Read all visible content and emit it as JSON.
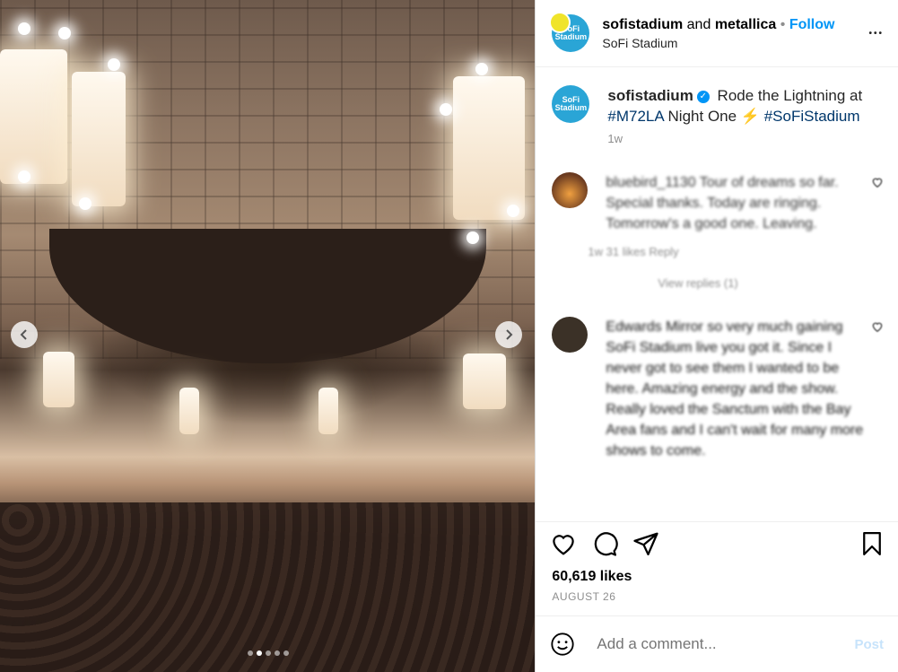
{
  "header": {
    "account": "sofistadium",
    "conjunction": "and",
    "collaborator": "metallica",
    "separator": "•",
    "follow_label": "Follow",
    "location": "SoFi Stadium",
    "avatar_text_1": "SoFi",
    "avatar_text_2": "Stadium",
    "more_label": "•••"
  },
  "caption": {
    "username": "sofistadium",
    "verified_mark": "✓",
    "text_before": "Rode the Lightning at",
    "hashtag_1": "#M72LA",
    "text_middle": "Night One",
    "emoji": "⚡",
    "hashtag_2": "#SoFiStadium",
    "time": "1w"
  },
  "comments": [
    {
      "text": "bluebird_1130 Tour of dreams so far. Special thanks. Today are ringing. Tomorrow's a good one. Leaving.",
      "meta": "1w  31 likes  Reply",
      "avatar_color": "#c97a2c"
    },
    {
      "text": "Edwards Mirror so very much gaining SoFi Stadium live you got it. Since I never got to see them I wanted to be here. Amazing energy and the show. Really loved the Sanctum with the Bay Area fans and I can't wait for many more shows to come.",
      "meta": "",
      "avatar_color": "#3b3127"
    }
  ],
  "view_replies": "View replies (1)",
  "likes": "60,619 likes",
  "date": "AUGUST 26",
  "add_comment": {
    "placeholder": "Add a comment...",
    "post_label": "Post"
  },
  "carousel": {
    "slide_count": 5,
    "active_slide": 2
  }
}
